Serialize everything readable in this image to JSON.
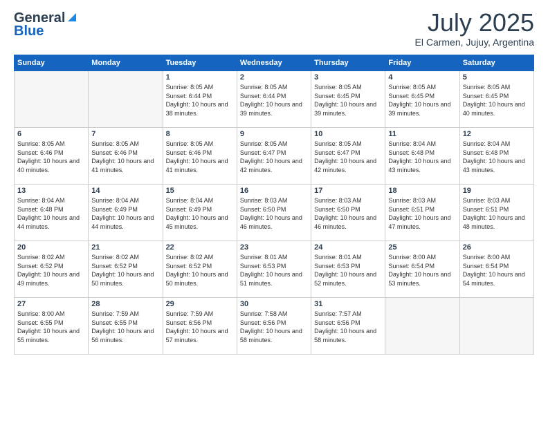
{
  "header": {
    "logo_general": "General",
    "logo_blue": "Blue",
    "month_year": "July 2025",
    "location": "El Carmen, Jujuy, Argentina"
  },
  "weekdays": [
    "Sunday",
    "Monday",
    "Tuesday",
    "Wednesday",
    "Thursday",
    "Friday",
    "Saturday"
  ],
  "weeks": [
    [
      {
        "day": "",
        "sunrise": "",
        "sunset": "",
        "daylight": ""
      },
      {
        "day": "",
        "sunrise": "",
        "sunset": "",
        "daylight": ""
      },
      {
        "day": "1",
        "sunrise": "Sunrise: 8:05 AM",
        "sunset": "Sunset: 6:44 PM",
        "daylight": "Daylight: 10 hours and 38 minutes."
      },
      {
        "day": "2",
        "sunrise": "Sunrise: 8:05 AM",
        "sunset": "Sunset: 6:44 PM",
        "daylight": "Daylight: 10 hours and 39 minutes."
      },
      {
        "day": "3",
        "sunrise": "Sunrise: 8:05 AM",
        "sunset": "Sunset: 6:45 PM",
        "daylight": "Daylight: 10 hours and 39 minutes."
      },
      {
        "day": "4",
        "sunrise": "Sunrise: 8:05 AM",
        "sunset": "Sunset: 6:45 PM",
        "daylight": "Daylight: 10 hours and 39 minutes."
      },
      {
        "day": "5",
        "sunrise": "Sunrise: 8:05 AM",
        "sunset": "Sunset: 6:45 PM",
        "daylight": "Daylight: 10 hours and 40 minutes."
      }
    ],
    [
      {
        "day": "6",
        "sunrise": "Sunrise: 8:05 AM",
        "sunset": "Sunset: 6:46 PM",
        "daylight": "Daylight: 10 hours and 40 minutes."
      },
      {
        "day": "7",
        "sunrise": "Sunrise: 8:05 AM",
        "sunset": "Sunset: 6:46 PM",
        "daylight": "Daylight: 10 hours and 41 minutes."
      },
      {
        "day": "8",
        "sunrise": "Sunrise: 8:05 AM",
        "sunset": "Sunset: 6:46 PM",
        "daylight": "Daylight: 10 hours and 41 minutes."
      },
      {
        "day": "9",
        "sunrise": "Sunrise: 8:05 AM",
        "sunset": "Sunset: 6:47 PM",
        "daylight": "Daylight: 10 hours and 42 minutes."
      },
      {
        "day": "10",
        "sunrise": "Sunrise: 8:05 AM",
        "sunset": "Sunset: 6:47 PM",
        "daylight": "Daylight: 10 hours and 42 minutes."
      },
      {
        "day": "11",
        "sunrise": "Sunrise: 8:04 AM",
        "sunset": "Sunset: 6:48 PM",
        "daylight": "Daylight: 10 hours and 43 minutes."
      },
      {
        "day": "12",
        "sunrise": "Sunrise: 8:04 AM",
        "sunset": "Sunset: 6:48 PM",
        "daylight": "Daylight: 10 hours and 43 minutes."
      }
    ],
    [
      {
        "day": "13",
        "sunrise": "Sunrise: 8:04 AM",
        "sunset": "Sunset: 6:48 PM",
        "daylight": "Daylight: 10 hours and 44 minutes."
      },
      {
        "day": "14",
        "sunrise": "Sunrise: 8:04 AM",
        "sunset": "Sunset: 6:49 PM",
        "daylight": "Daylight: 10 hours and 44 minutes."
      },
      {
        "day": "15",
        "sunrise": "Sunrise: 8:04 AM",
        "sunset": "Sunset: 6:49 PM",
        "daylight": "Daylight: 10 hours and 45 minutes."
      },
      {
        "day": "16",
        "sunrise": "Sunrise: 8:03 AM",
        "sunset": "Sunset: 6:50 PM",
        "daylight": "Daylight: 10 hours and 46 minutes."
      },
      {
        "day": "17",
        "sunrise": "Sunrise: 8:03 AM",
        "sunset": "Sunset: 6:50 PM",
        "daylight": "Daylight: 10 hours and 46 minutes."
      },
      {
        "day": "18",
        "sunrise": "Sunrise: 8:03 AM",
        "sunset": "Sunset: 6:51 PM",
        "daylight": "Daylight: 10 hours and 47 minutes."
      },
      {
        "day": "19",
        "sunrise": "Sunrise: 8:03 AM",
        "sunset": "Sunset: 6:51 PM",
        "daylight": "Daylight: 10 hours and 48 minutes."
      }
    ],
    [
      {
        "day": "20",
        "sunrise": "Sunrise: 8:02 AM",
        "sunset": "Sunset: 6:52 PM",
        "daylight": "Daylight: 10 hours and 49 minutes."
      },
      {
        "day": "21",
        "sunrise": "Sunrise: 8:02 AM",
        "sunset": "Sunset: 6:52 PM",
        "daylight": "Daylight: 10 hours and 50 minutes."
      },
      {
        "day": "22",
        "sunrise": "Sunrise: 8:02 AM",
        "sunset": "Sunset: 6:52 PM",
        "daylight": "Daylight: 10 hours and 50 minutes."
      },
      {
        "day": "23",
        "sunrise": "Sunrise: 8:01 AM",
        "sunset": "Sunset: 6:53 PM",
        "daylight": "Daylight: 10 hours and 51 minutes."
      },
      {
        "day": "24",
        "sunrise": "Sunrise: 8:01 AM",
        "sunset": "Sunset: 6:53 PM",
        "daylight": "Daylight: 10 hours and 52 minutes."
      },
      {
        "day": "25",
        "sunrise": "Sunrise: 8:00 AM",
        "sunset": "Sunset: 6:54 PM",
        "daylight": "Daylight: 10 hours and 53 minutes."
      },
      {
        "day": "26",
        "sunrise": "Sunrise: 8:00 AM",
        "sunset": "Sunset: 6:54 PM",
        "daylight": "Daylight: 10 hours and 54 minutes."
      }
    ],
    [
      {
        "day": "27",
        "sunrise": "Sunrise: 8:00 AM",
        "sunset": "Sunset: 6:55 PM",
        "daylight": "Daylight: 10 hours and 55 minutes."
      },
      {
        "day": "28",
        "sunrise": "Sunrise: 7:59 AM",
        "sunset": "Sunset: 6:55 PM",
        "daylight": "Daylight: 10 hours and 56 minutes."
      },
      {
        "day": "29",
        "sunrise": "Sunrise: 7:59 AM",
        "sunset": "Sunset: 6:56 PM",
        "daylight": "Daylight: 10 hours and 57 minutes."
      },
      {
        "day": "30",
        "sunrise": "Sunrise: 7:58 AM",
        "sunset": "Sunset: 6:56 PM",
        "daylight": "Daylight: 10 hours and 58 minutes."
      },
      {
        "day": "31",
        "sunrise": "Sunrise: 7:57 AM",
        "sunset": "Sunset: 6:56 PM",
        "daylight": "Daylight: 10 hours and 58 minutes."
      },
      {
        "day": "",
        "sunrise": "",
        "sunset": "",
        "daylight": ""
      },
      {
        "day": "",
        "sunrise": "",
        "sunset": "",
        "daylight": ""
      }
    ]
  ]
}
